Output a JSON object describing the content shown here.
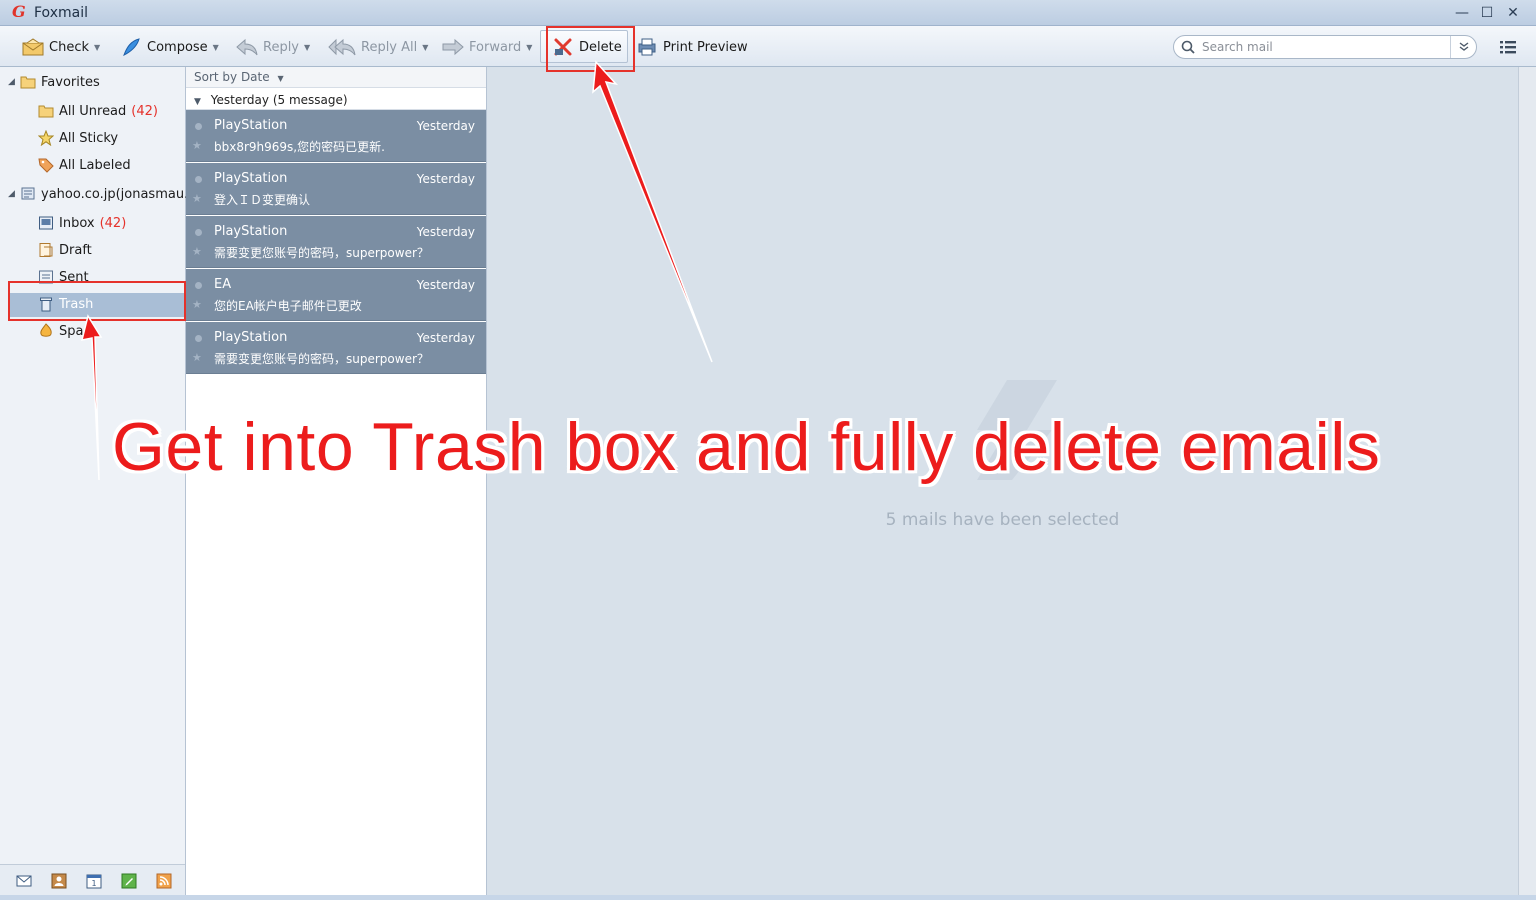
{
  "window": {
    "app_title": "Foxmail",
    "minimize": "—",
    "maximize": "☐",
    "close": "✕"
  },
  "toolbar": {
    "check": "Check",
    "compose": "Compose",
    "reply": "Reply",
    "reply_all": "Reply All",
    "forward": "Forward",
    "delete": "Delete",
    "print_preview": "Print Preview",
    "search_placeholder": "Search mail"
  },
  "sidebar": {
    "favorites": "Favorites",
    "all_unread": "All Unread",
    "all_unread_count": "(42)",
    "all_sticky": "All Sticky",
    "all_labeled": "All Labeled",
    "account": "yahoo.co.jp(jonasmau...",
    "inbox": "Inbox",
    "inbox_count": "(42)",
    "draft": "Draft",
    "sent": "Sent",
    "trash": "Trash",
    "spam": "Spa"
  },
  "list": {
    "sort_label": "Sort by Date",
    "group_label": "Yesterday (5 message)",
    "mails": [
      {
        "sender": "PlayStation",
        "date": "Yesterday",
        "subject": "bbx8r9h969s,您的密码已更新."
      },
      {
        "sender": "PlayStation",
        "date": "Yesterday",
        "subject": "登入ＩＤ变更确认"
      },
      {
        "sender": "PlayStation",
        "date": "Yesterday",
        "subject": "需要变更您账号的密码，superpower？"
      },
      {
        "sender": "EA",
        "date": "Yesterday",
        "subject": "您的EA帐户电子邮件已更改"
      },
      {
        "sender": "PlayStation",
        "date": "Yesterday",
        "subject": "需要变更您账号的密码，superpower？"
      }
    ]
  },
  "reader": {
    "status": "5 mails have been selected"
  },
  "annotation": {
    "banner": "Get into Trash box and fully delete emails",
    "color": "#ec1c1c"
  }
}
